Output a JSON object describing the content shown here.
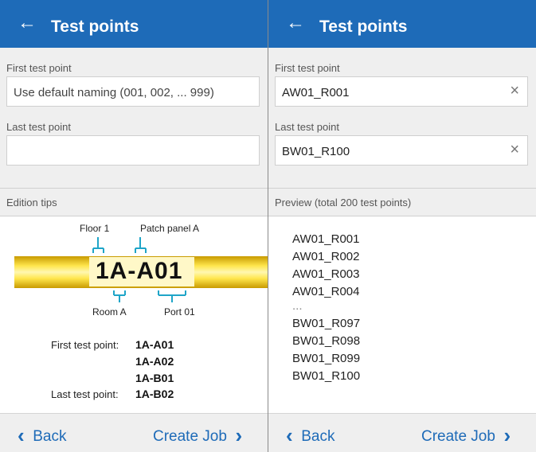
{
  "left": {
    "title": "Test points",
    "first_label": "First test point",
    "first_value": "Use default naming (001, 002, ... 999)",
    "last_label": "Last test point",
    "last_value": "",
    "section_title": "Edition tips",
    "diagram": {
      "floor": "Floor 1",
      "patch": "Patch panel A",
      "code": "1A-A01",
      "room": "Room A",
      "port": "Port 01"
    },
    "examples": {
      "first_label": "First test point:",
      "values": [
        "1A-A01",
        "1A-A02",
        "1A-B01",
        "1A-B02"
      ],
      "last_label": "Last test point:"
    },
    "back": "Back",
    "create": "Create Job"
  },
  "right": {
    "title": "Test points",
    "first_label": "First test point",
    "first_value": "AW01_R001",
    "last_label": "Last test point",
    "last_value": "BW01_R100",
    "section_title": "Preview (total 200 test points)",
    "preview": [
      "AW01_R001",
      "AW01_R002",
      "AW01_R003",
      "AW01_R004",
      "...",
      "BW01_R097",
      "BW01_R098",
      "BW01_R099",
      "BW01_R100"
    ],
    "back": "Back",
    "create": "Create Job"
  },
  "icons": {
    "back_arrow": "←",
    "clear": "×",
    "chevron_left": "‹",
    "chevron_right": "›"
  },
  "colors": {
    "appbar": "#1e6bb8",
    "accent": "#1e6bb8",
    "panel": "#efefef"
  }
}
